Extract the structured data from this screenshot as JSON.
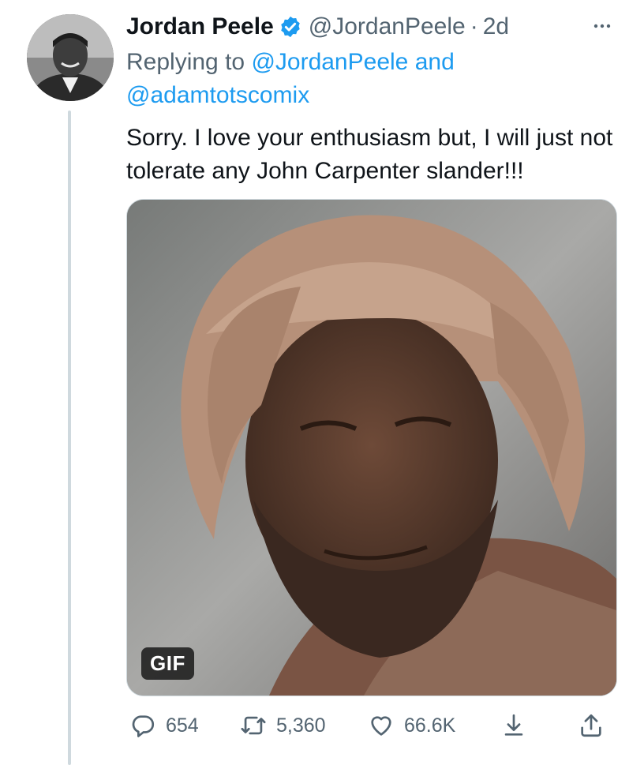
{
  "tweet": {
    "author_name": "Jordan Peele",
    "handle": "@JordanPeele",
    "separator": "·",
    "time": "2d",
    "reply_prefix": "Replying to",
    "reply_to_1": "@JordanPeele",
    "reply_and": "and",
    "reply_to_2": "@adamtotscomix",
    "text": "Sorry. I love your enthusiasm but, I will just not tolerate any John Carpenter slander!!!",
    "media_badge": "GIF"
  },
  "actions": {
    "replies": "654",
    "retweets": "5,360",
    "likes": "66.6K"
  },
  "icons": [
    "verified-badge-icon",
    "more-icon",
    "reply-icon",
    "retweet-icon",
    "like-icon",
    "bookmark-icon",
    "share-icon"
  ],
  "colors": {
    "accent": "#1d9bf0",
    "muted": "#536471",
    "text": "#0f1419",
    "thread_line": "#cfd9de"
  }
}
